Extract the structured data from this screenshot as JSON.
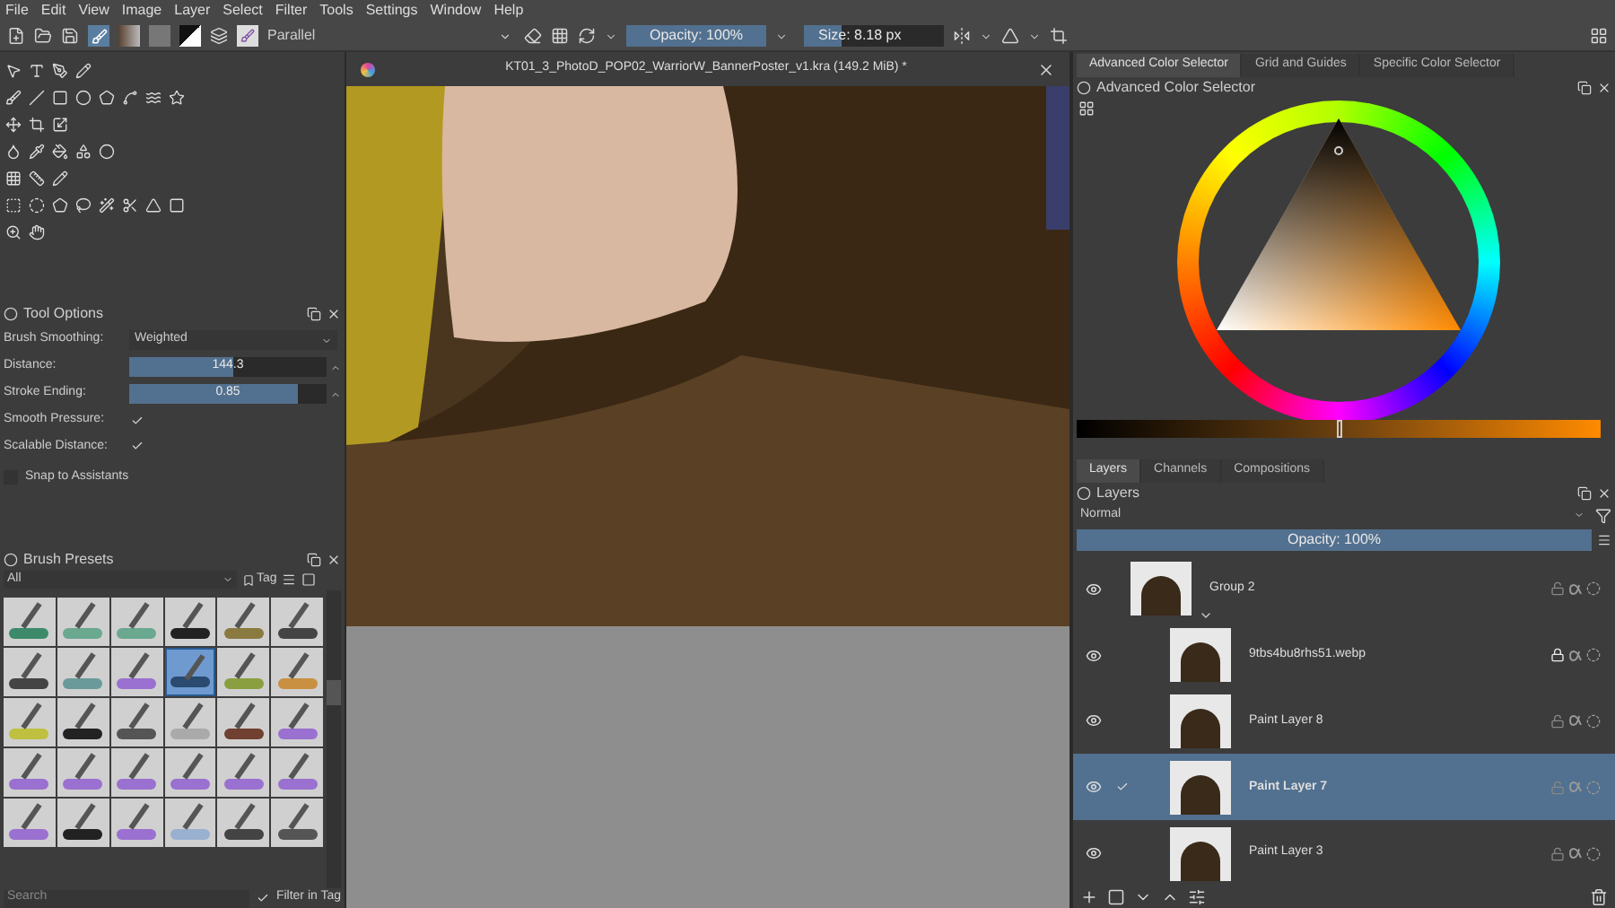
{
  "menu": [
    "File",
    "Edit",
    "View",
    "Image",
    "Layer",
    "Select",
    "Filter",
    "Tools",
    "Settings",
    "Window",
    "Help"
  ],
  "toolbar": {
    "preset": "Parallel",
    "opacity": {
      "label": "Opacity: 100%",
      "level": 1
    },
    "size": {
      "label": "Size: 8.18 px",
      "level": 0.27
    }
  },
  "tool_options": {
    "title": "Tool Options",
    "smoothing_label": "Brush Smoothing:",
    "smoothing_value": "Weighted",
    "sliders": [
      {
        "label": "Distance:",
        "value": "144.3",
        "level": 0.53
      },
      {
        "label": "Stroke Ending:",
        "value": "0.85",
        "level": 0.85
      }
    ],
    "checks": [
      {
        "label": "Smooth Pressure:",
        "checked": true
      },
      {
        "label": "Scalable Distance:",
        "checked": true
      }
    ],
    "snap": {
      "label": "Snap to Assistants",
      "checked": false
    }
  },
  "brush_presets": {
    "title": "Brush Presets",
    "filter": "All",
    "tag": "Tag",
    "search_placeholder": "Search",
    "filter_in_tag": {
      "label": "Filter in Tag",
      "checked": true
    },
    "presets": [
      {
        "selected": false
      },
      {
        "selected": false
      },
      {
        "selected": false
      },
      {
        "selected": false
      },
      {
        "selected": false
      },
      {
        "selected": false
      },
      {
        "selected": false
      },
      {
        "selected": false
      },
      {
        "selected": false
      },
      {
        "selected": true
      },
      {
        "selected": false
      },
      {
        "selected": false
      },
      {
        "selected": false
      },
      {
        "selected": false
      },
      {
        "selected": false
      },
      {
        "selected": false
      },
      {
        "selected": false
      },
      {
        "selected": false
      },
      {
        "selected": false
      },
      {
        "selected": false
      },
      {
        "selected": false
      },
      {
        "selected": false
      },
      {
        "selected": false
      },
      {
        "selected": false
      },
      {
        "selected": false
      },
      {
        "selected": false
      },
      {
        "selected": false
      },
      {
        "selected": false
      },
      {
        "selected": false
      },
      {
        "selected": false
      }
    ]
  },
  "document": {
    "title": "KT01_3_PhotoD_POP02_WarriorW_BannerPoster_v1.kra (149.2 MiB) *"
  },
  "color_tabs": [
    {
      "label": "Advanced Color Selector",
      "selected": true
    },
    {
      "label": "Grid and Guides",
      "selected": false
    },
    {
      "label": "Specific Color Selector",
      "selected": false
    }
  ],
  "color_docker": {
    "title": "Advanced Color Selector",
    "shade_slider": {
      "level": 0.5
    }
  },
  "layer_tabs": [
    {
      "label": "Layers",
      "selected": true
    },
    {
      "label": "Channels",
      "selected": false
    },
    {
      "label": "Compositions",
      "selected": false
    }
  ],
  "layers_docker": {
    "title": "Layers",
    "blend": "Normal",
    "opacity": {
      "label": "Opacity:  100%",
      "level": 1
    },
    "layers": [
      {
        "name": "Group 2",
        "selected": false,
        "checked": false,
        "locked": false,
        "expanded": true,
        "children": [
          {
            "name": "9tbs4bu8rhs51.webp",
            "selected": false,
            "checked": false,
            "locked": true
          },
          {
            "name": "Paint Layer 8",
            "selected": false,
            "checked": false,
            "locked": false
          },
          {
            "name": "Paint Layer 7",
            "selected": true,
            "checked": true,
            "locked": false
          },
          {
            "name": "Paint Layer 3",
            "selected": false,
            "checked": false,
            "locked": false
          }
        ]
      }
    ]
  }
}
